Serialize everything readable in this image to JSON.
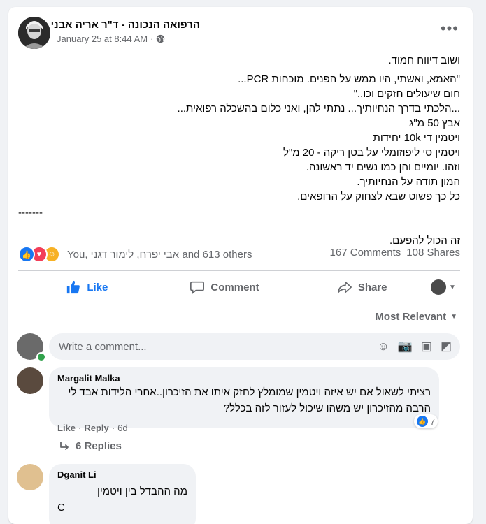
{
  "post": {
    "author": "הרפואה הנכונה - ד\"ר אריה אבני",
    "time": "January 25 at 8:44 AM",
    "more_label": "•••",
    "body_lines": [
      "ושוב דיווח חמוד.",
      "\"האמא, ואשתי, היו ממש על הפנים. מוכחות PCR...",
      "חום שיעולים חזקים וכו..\"",
      "...הלכתי בדרך הנחיותיך... נתתי להן, ואני כלום בהשכלה רפואית...",
      "אבץ 50 מ\"ג",
      "ויטמין די 10k יחידות",
      "ויטמין סי ליפוזומלי על בטן ריקה - 20 מ\"ל",
      "וזהו. יומיים והן כמו נשים יד ראשונה.",
      "המון תודה על הנחיותיך.",
      "כל כך פשוט שבא לצחוק על הרופאים.",
      "זה הכול להפעם."
    ],
    "dashes": "-------"
  },
  "reactions": {
    "names": "You, אבי יפרח, לימור דגני and 613 others",
    "comments": "167 Comments",
    "shares": "108 Shares"
  },
  "actions": {
    "like": "Like",
    "comment": "Comment",
    "share": "Share"
  },
  "sort_label": "Most Relevant",
  "composer": {
    "placeholder": "Write a comment..."
  },
  "comments": [
    {
      "name": "Margalit Malka",
      "text_1": "רציתי לשאול אם יש איזה ויטמין שמומלץ לחזק איתו את הזיכרון..אחרי הלידות אבד לי",
      "text_2": "הרבה מהזיכרון יש משהו שיכול לעזור לזה בכלל?",
      "like": "Like",
      "reply": "Reply",
      "age": "6d",
      "likes": "7",
      "replies": "6 Replies"
    },
    {
      "name": "Dganit Li",
      "text_1": "מה ההבדל בין ויטמין",
      "text_2": "C"
    }
  ],
  "colors": {
    "accent": "#1877f2",
    "text": "#050505",
    "secondary": "#65676b",
    "background": "#f0f2f5"
  }
}
